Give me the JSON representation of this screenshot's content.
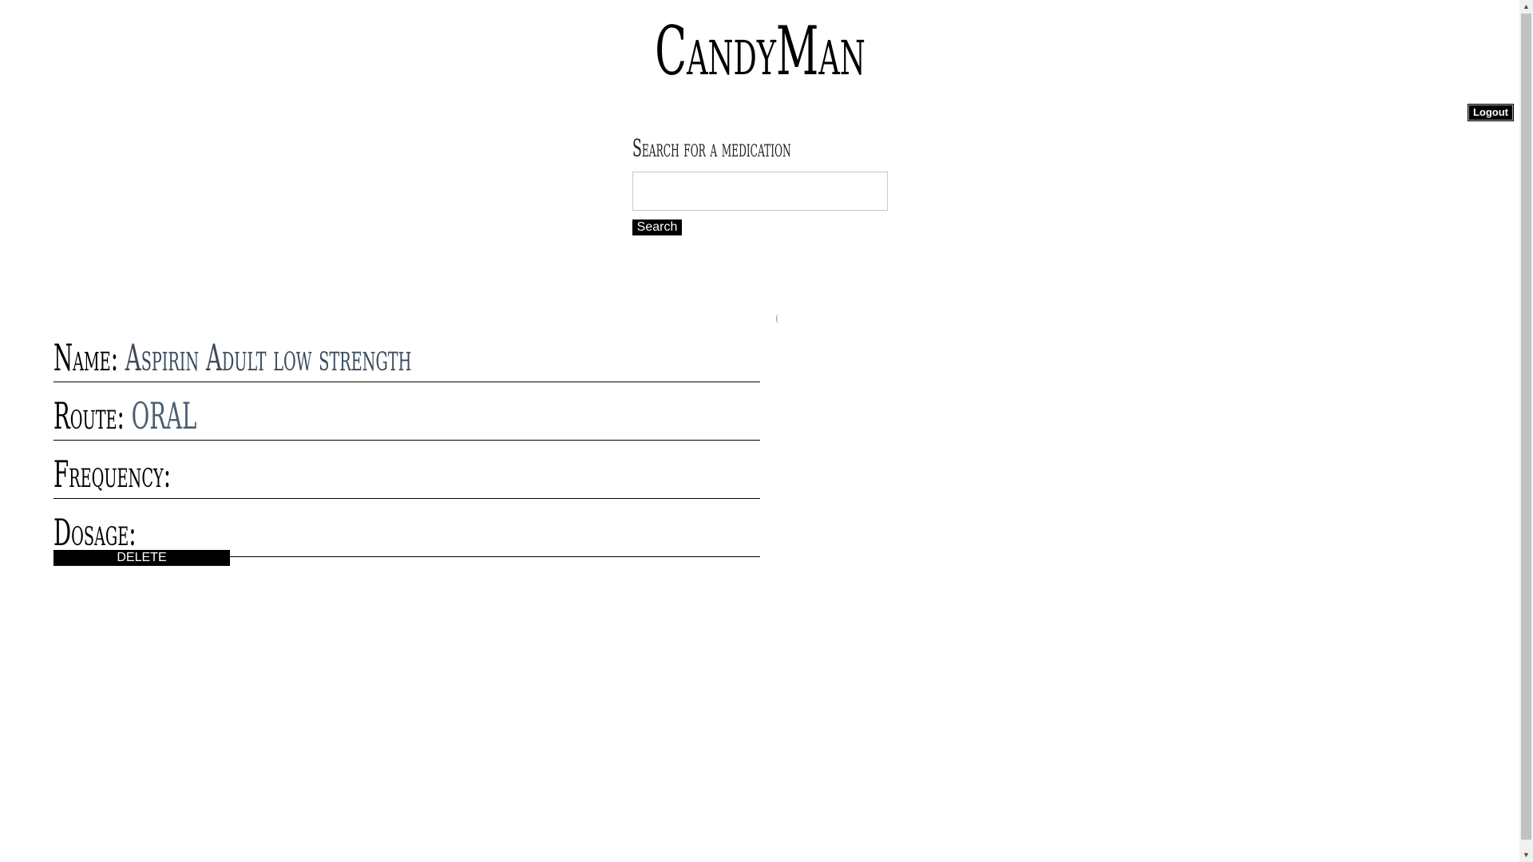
{
  "header": {
    "app_title": "CandyMan",
    "logout_label": "Logout"
  },
  "search": {
    "label": "Search for a medication",
    "input_value": "",
    "placeholder": "",
    "button_label": "Search"
  },
  "misc": {
    "stray_mark": "("
  },
  "medication": {
    "fields": [
      {
        "label": "Name:",
        "value": "Aspirin Adult low strength"
      },
      {
        "label": "Route:",
        "value": "ORAL"
      },
      {
        "label": "Frequency:",
        "value": ""
      },
      {
        "label": "Dosage:",
        "value": ""
      }
    ],
    "delete_label": "DELETE"
  },
  "scrollbar": {
    "up_icon": "▲",
    "down_icon": "▼"
  }
}
